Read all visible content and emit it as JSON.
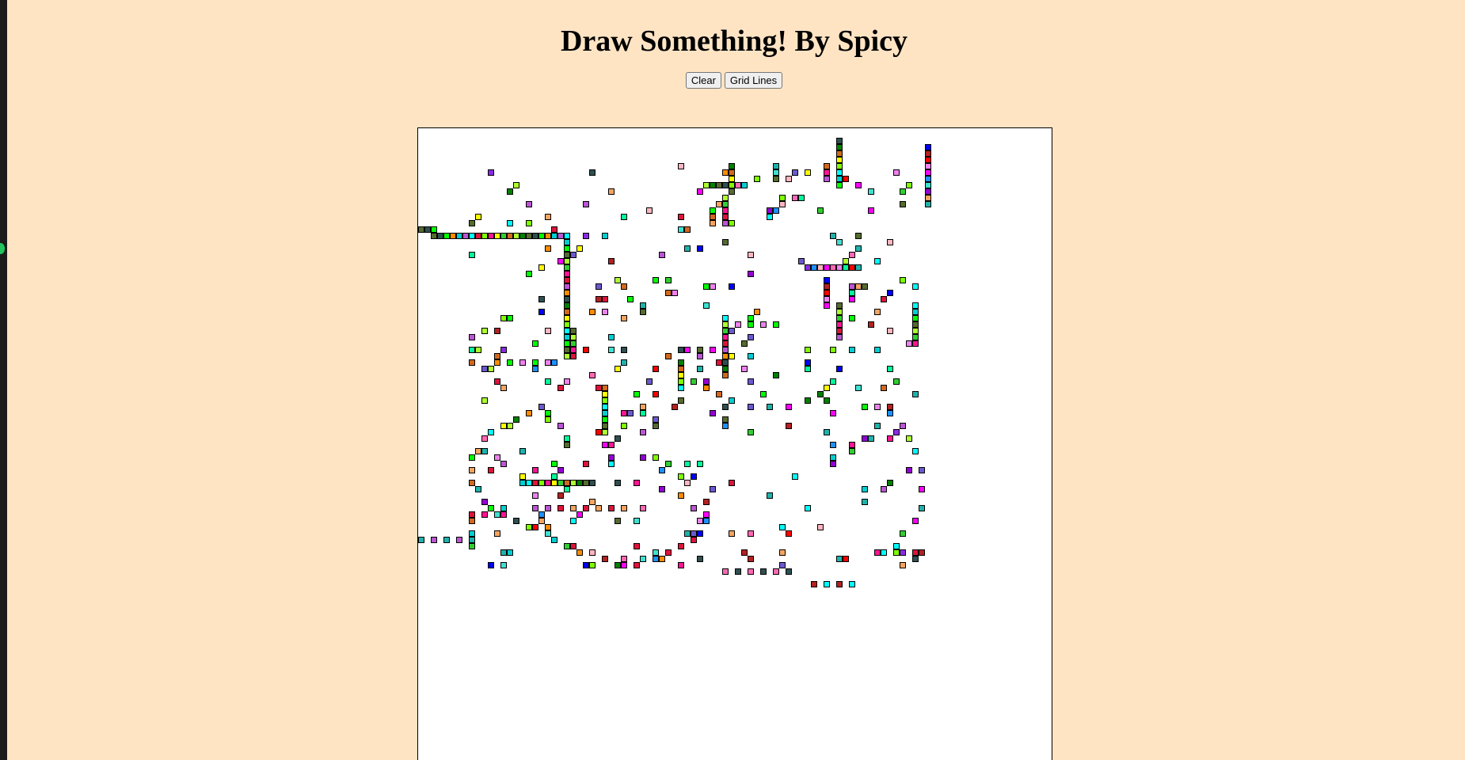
{
  "page": {
    "title": "Draw Something! By Spicy",
    "background": "#ffe4c4"
  },
  "controls": {
    "clear_label": "Clear",
    "grid_label": "Grid Lines"
  },
  "canvas": {
    "background": "#ffffff",
    "cell_border": "#000000",
    "palette": [
      "#ff00ff",
      "#00ff00",
      "#ff0000",
      "#00ffff",
      "#0000ff",
      "#ffff00",
      "#8a2be2",
      "#008000",
      "#ff69b4",
      "#ff8c00",
      "#20b2aa",
      "#dc143c",
      "#9400d3",
      "#32cd32",
      "#1e90ff",
      "#556b2f",
      "#ee82ee",
      "#00ced1",
      "#b22222",
      "#7fff00",
      "#6a5acd",
      "#d2691e",
      "#ffb6c1",
      "#2f4f4f",
      "#00fa9a",
      "#ba55d3",
      "#f4a460",
      "#ff1493",
      "#40e0d0",
      "#adff2f"
    ]
  }
}
